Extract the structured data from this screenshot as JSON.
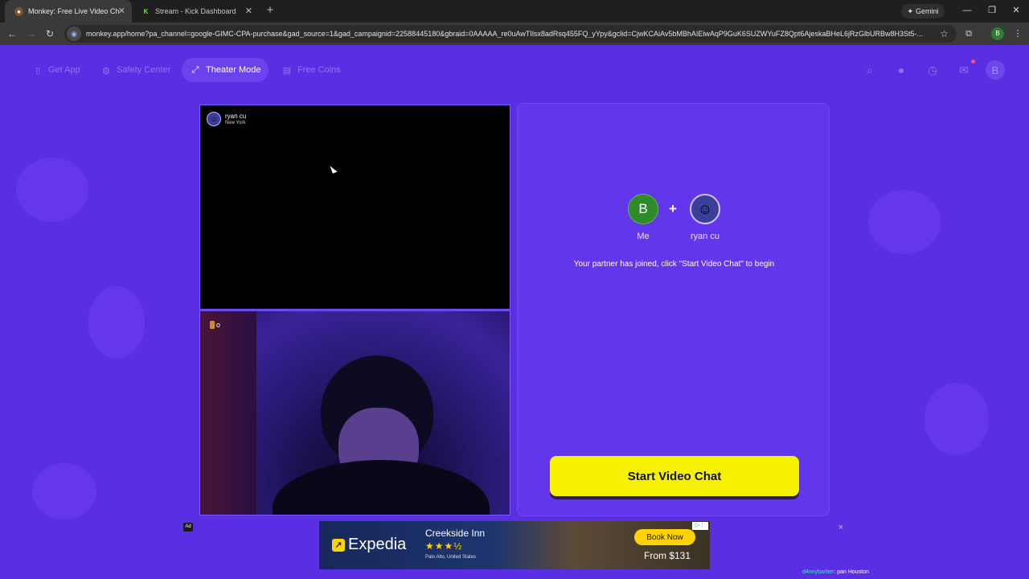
{
  "browser": {
    "tabs": [
      {
        "title": "Monkey: Free Live Video Ch",
        "active": true
      },
      {
        "title": "Stream - Kick Dashboard",
        "active": false
      }
    ],
    "gemini_label": "Gemini",
    "url": "monkey.app/home?pa_channel=google-GIMC-CPA-purchase&gad_source=1&gad_campaignid=22588445180&gbraid=0AAAAA_re0uAwTIlsx8adRsq455FQ_yYpy&gclid=CjwKCAiAv5bMBhAIEiwAqP9GuK6SUZWYuFZ8Qpt6AjeskaBHeL6jRzGlbURBw8H3St5-...",
    "profile_initial": "B"
  },
  "nav": {
    "items": [
      {
        "label": "Get App",
        "icon": "phone-icon"
      },
      {
        "label": "Safety Center",
        "icon": "shield-icon"
      },
      {
        "label": "Theater Mode",
        "icon": "expand-icon"
      },
      {
        "label": "Free Coins",
        "icon": "coins-icon"
      }
    ],
    "avatar_initial": "B"
  },
  "video": {
    "partner_name": "ryan cu",
    "partner_location": "New York",
    "self_badge": "o"
  },
  "panel": {
    "me_initial": "B",
    "me_label": "Me",
    "partner_label": "ryan cu",
    "message": "Your partner has joined, click \"Start Video Chat\" to begin",
    "start_button": "Start Video Chat"
  },
  "ad": {
    "ad_label": "Ad",
    "brand": "Expedia",
    "hotel": "Creekside Inn",
    "stars": "★★★½",
    "location": "Palo Alto, United States",
    "cta": "Book Now",
    "price": "From $131",
    "close": "×"
  },
  "credit": {
    "user": "d4nnybarber",
    "text": ": pan Houston"
  },
  "colors": {
    "background": "#5a2ee2",
    "button_yellow": "#f7f300",
    "accent_purple": "#6236ea"
  }
}
